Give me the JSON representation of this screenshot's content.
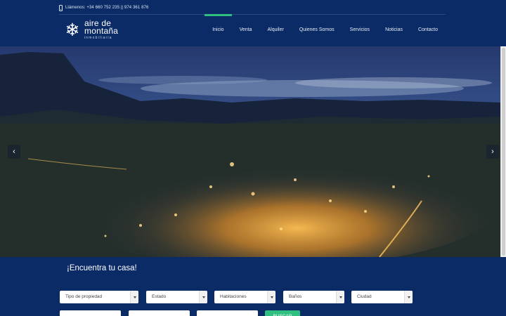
{
  "topbar": {
    "contact_text": "Llámenos: +34 660 752 235 || 974 361 876"
  },
  "logo": {
    "line1": "aire de",
    "line2": "montaña",
    "sub": "inmobiliaria"
  },
  "nav": {
    "items": [
      {
        "label": "Inicio",
        "active": true
      },
      {
        "label": "Venta",
        "active": false
      },
      {
        "label": "Alquiler",
        "active": false
      },
      {
        "label": "Quienes Somos",
        "active": false
      },
      {
        "label": "Servicios",
        "active": false
      },
      {
        "label": "Noticias",
        "active": false
      },
      {
        "label": "Contacto",
        "active": false
      }
    ]
  },
  "hero": {
    "prev_icon": "chevron-left-icon",
    "next_icon": "chevron-right-icon"
  },
  "search": {
    "title": "¡Encuentra tu casa!",
    "selects": [
      {
        "label": "Tipo de propiedad"
      },
      {
        "label": "Estado"
      },
      {
        "label": "Habitaciones"
      },
      {
        "label": "Baños"
      },
      {
        "label": "Ciudad"
      }
    ],
    "button_label": "BUSCAR"
  },
  "colors": {
    "header_bg": "#0b2b66",
    "accent": "#2fbf80"
  }
}
